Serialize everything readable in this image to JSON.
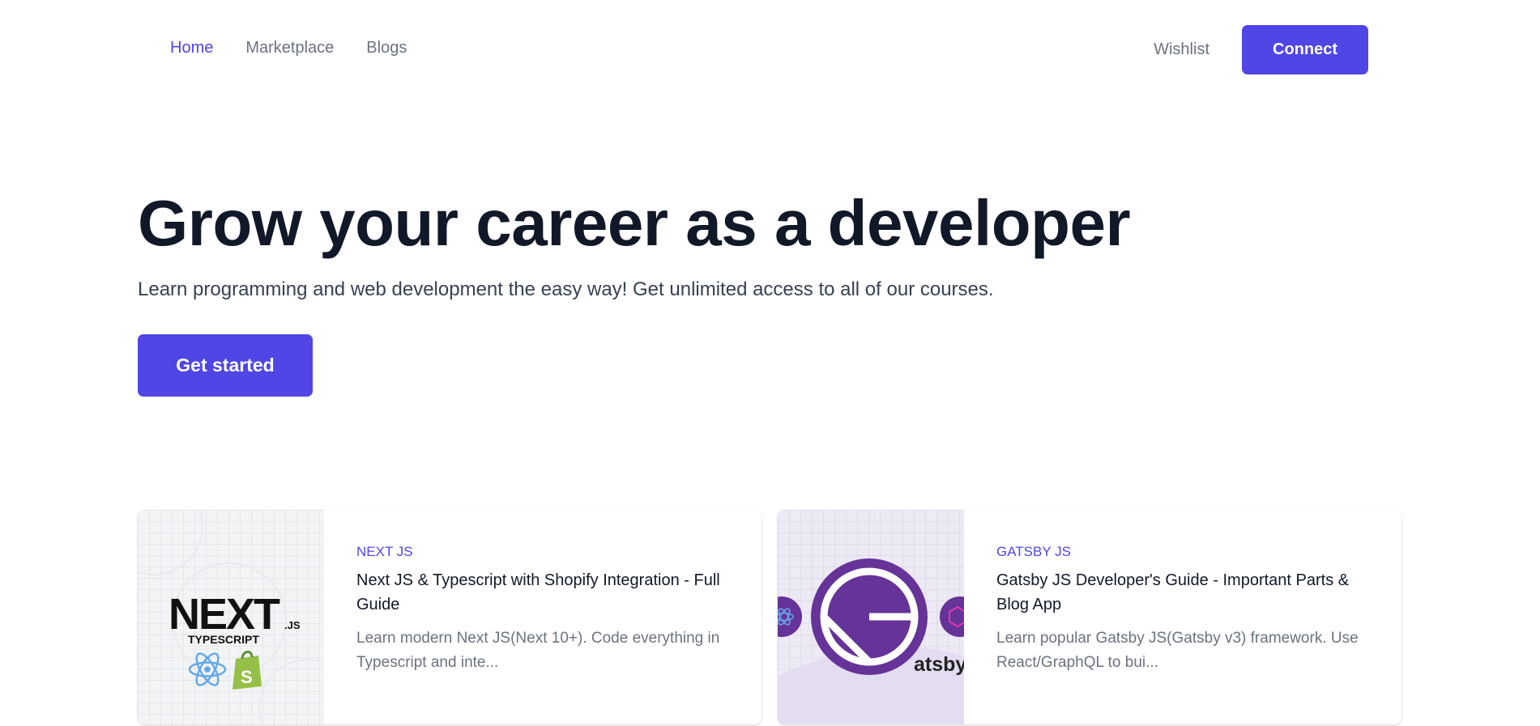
{
  "nav": {
    "links": [
      {
        "label": "Home",
        "active": true
      },
      {
        "label": "Marketplace",
        "active": false
      },
      {
        "label": "Blogs",
        "active": false
      }
    ],
    "wishlist_label": "Wishlist",
    "connect_label": "Connect"
  },
  "hero": {
    "title": "Grow your career as a developer",
    "subtitle": "Learn programming and web development the easy way! Get unlimited access to all of our courses.",
    "cta_label": "Get started"
  },
  "courses": [
    {
      "category": "NEXT JS",
      "title": "Next JS & Typescript with Shopify Integration - Full Guide",
      "description": "Learn modern Next JS(Next 10+). Code everything in Typescript and inte...",
      "image_icon": "nextjs-typescript-shopify-logo",
      "logo_main": "NEXT",
      "logo_sub": ".JS",
      "logo_line2": "TYPESCRIPT",
      "logo_badge": "S"
    },
    {
      "category": "GATSBY JS",
      "title": "Gatsby JS Developer's Guide - Important Parts & Blog App",
      "description": "Learn popular Gatsby JS(Gatsby v3) framework. Use React/GraphQL to bui...",
      "image_icon": "gatsby-logo",
      "logo_text": "atsby"
    }
  ],
  "colors": {
    "accent": "#4f46e5",
    "heading": "#111827",
    "muted": "#6b7280"
  }
}
